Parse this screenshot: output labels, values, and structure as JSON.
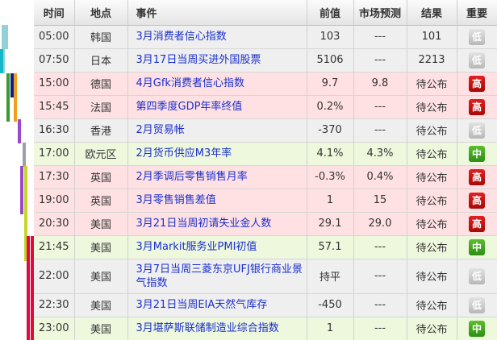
{
  "colors": {
    "gray_row": "#efefef",
    "pink_row": "#ffe1e3",
    "green_row": "#eef8dd",
    "event_link": "#1a2fcf",
    "importance_low": "#bdbdbd",
    "importance_high": "#c81414",
    "importance_mid": "#3fa11f"
  },
  "headers": {
    "time": "时间",
    "location": "地点",
    "event": "事件",
    "previous": "前值",
    "forecast": "市场预测",
    "result": "结果",
    "importance": "重要"
  },
  "rows": [
    {
      "time": "05:00",
      "location": "韩国",
      "event": "3月消费者信心指数",
      "previous": "103",
      "forecast": "---",
      "result": "101",
      "importance": "低",
      "level": "low",
      "bg": "gray"
    },
    {
      "time": "07:50",
      "location": "日本",
      "event": "3月17日当周买进外国股票",
      "previous": "5106",
      "forecast": "---",
      "result": "2213",
      "importance": "低",
      "level": "low",
      "bg": "gray"
    },
    {
      "time": "15:00",
      "location": "德国",
      "event": "4月Gfk消费者信心指数",
      "previous": "9.7",
      "forecast": "9.8",
      "result": "待公布",
      "importance": "高",
      "level": "high",
      "bg": "pink"
    },
    {
      "time": "15:45",
      "location": "法国",
      "event": "第四季度GDP年率终值",
      "previous": "0.2%",
      "forecast": "---",
      "result": "待公布",
      "importance": "高",
      "level": "high",
      "bg": "pink"
    },
    {
      "time": "16:30",
      "location": "香港",
      "event": "2月贸易帐",
      "previous": "-370",
      "forecast": "---",
      "result": "待公布",
      "importance": "低",
      "level": "low",
      "bg": "gray"
    },
    {
      "time": "17:00",
      "location": "欧元区",
      "event": "2月货币供应M3年率",
      "previous": "4.1%",
      "forecast": "4.3%",
      "result": "待公布",
      "importance": "中",
      "level": "mid",
      "bg": "green"
    },
    {
      "time": "17:30",
      "location": "英国",
      "event": "2月季调后零售销售月率",
      "previous": "-0.3%",
      "forecast": "0.4%",
      "result": "待公布",
      "importance": "高",
      "level": "high",
      "bg": "pink"
    },
    {
      "time": "19:00",
      "location": "英国",
      "event": "3月零售销售差值",
      "previous": "1",
      "forecast": "15",
      "result": "待公布",
      "importance": "高",
      "level": "high",
      "bg": "pink"
    },
    {
      "time": "20:30",
      "location": "美国",
      "event": "3月21日当周初请失业金人数",
      "previous": "29.1",
      "forecast": "29.0",
      "result": "待公布",
      "importance": "高",
      "level": "high",
      "bg": "pink"
    },
    {
      "time": "21:45",
      "location": "美国",
      "event": "3月Markit服务业PMI初值",
      "previous": "57.1",
      "forecast": "---",
      "result": "待公布",
      "importance": "中",
      "level": "mid",
      "bg": "green"
    },
    {
      "time": "22:00",
      "location": "美国",
      "event": "3月7日当周三菱东京UFJ银行商业景气指数",
      "previous": "持平",
      "forecast": "---",
      "result": "待公布",
      "importance": "低",
      "level": "low",
      "bg": "gray",
      "tall": true
    },
    {
      "time": "22:30",
      "location": "美国",
      "event": "3月21日当周EIA天然气库存",
      "previous": "-450",
      "forecast": "---",
      "result": "待公布",
      "importance": "低",
      "level": "low",
      "bg": "gray"
    },
    {
      "time": "23:00",
      "location": "美国",
      "event": "3月堪萨斯联储制造业综合指数",
      "previous": "1",
      "forecast": "---",
      "result": "待公布",
      "importance": "中",
      "level": "mid",
      "bg": "green"
    }
  ]
}
